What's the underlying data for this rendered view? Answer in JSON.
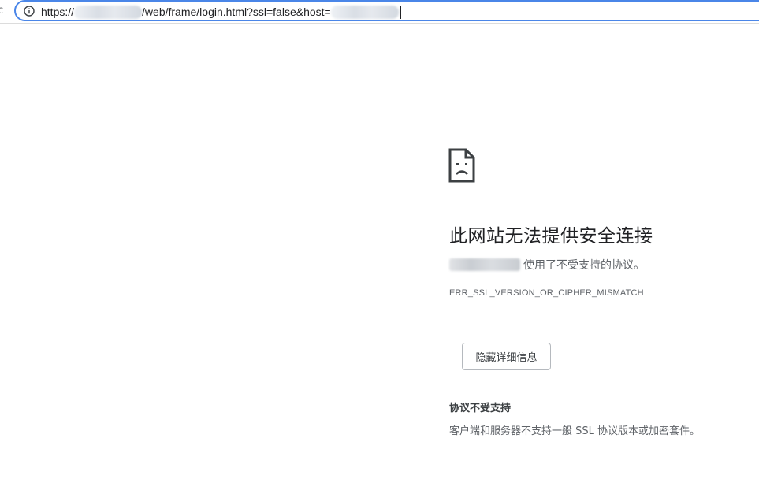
{
  "address_bar": {
    "reload_glyph": "c",
    "info_icon": "info-icon",
    "url_prefix": "https://",
    "url_path": "/web/frame/login.html?ssl=false&host=",
    "accent_color": "#4a86e8"
  },
  "error_page": {
    "icon": "sad-page-icon",
    "heading": "此网站无法提供安全连接",
    "description_suffix": "使用了不受支持的协议。",
    "error_code": "ERR_SSL_VERSION_OR_CIPHER_MISMATCH",
    "details_button_label": "隐藏详细信息",
    "details_title": "协议不受支持",
    "details_text": "客户端和服务器不支持一般 SSL 协议版本或加密套件。"
  }
}
